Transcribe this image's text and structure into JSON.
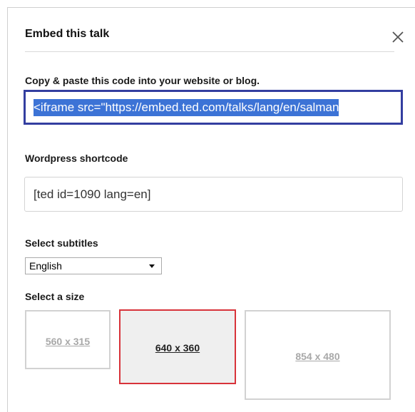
{
  "dialog": {
    "title": "Embed this talk",
    "close_icon": "close-icon"
  },
  "embed_code": {
    "label": "Copy & paste this code into your website or blog.",
    "value": "<iframe src=\"https://embed.ted.com/talks/lang/en/salman"
  },
  "wordpress": {
    "label": "Wordpress shortcode",
    "value": "[ted id=1090 lang=en]"
  },
  "subtitles": {
    "label": "Select subtitles",
    "selected": "English",
    "dropdown_icon": "chevron-down-icon"
  },
  "size": {
    "label": "Select a size",
    "options": [
      {
        "label": "560 x 315",
        "selected": false
      },
      {
        "label": "640 x 360",
        "selected": true
      },
      {
        "label": "854 x 480",
        "selected": false
      }
    ]
  },
  "colors": {
    "code_border": "#333ea0",
    "selection_highlight": "#3c73d6",
    "selected_size_border": "#d8333a"
  }
}
